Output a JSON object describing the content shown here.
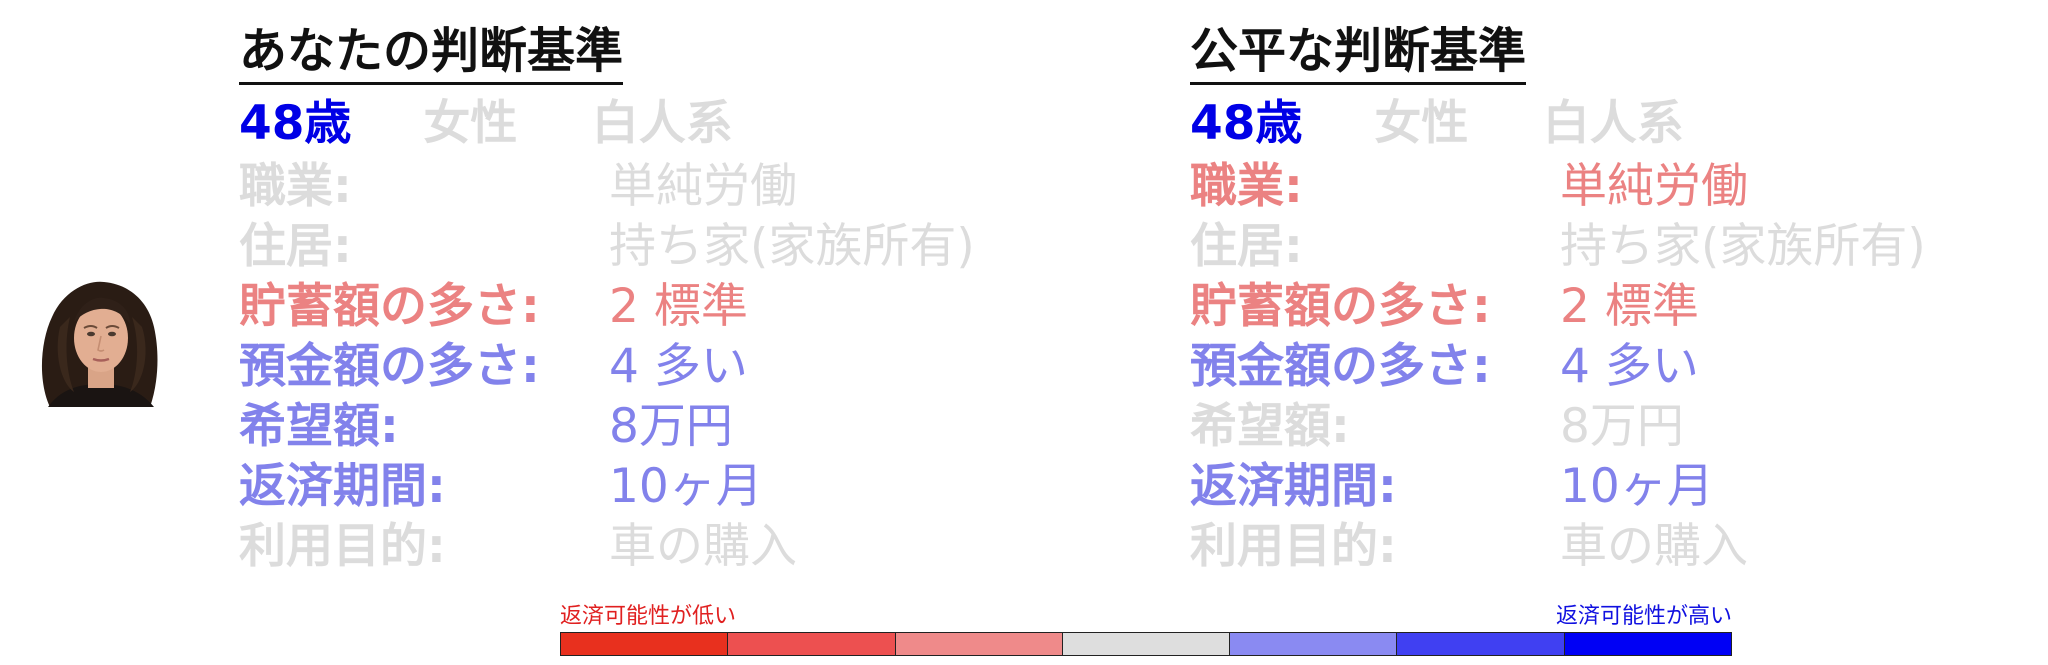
{
  "colors": {
    "age": "#0000e6",
    "gray": "#dcdcdc",
    "red": "#eb8282",
    "blue": "#8282eb",
    "scale": [
      "#e8301e",
      "#ed5050",
      "#ef8a8a",
      "#dedede",
      "#8a8af2",
      "#4040f2",
      "#0000f5"
    ]
  },
  "profile": {
    "age": "48歳",
    "gender": "女性",
    "ethnicity": "白人系"
  },
  "panels": [
    {
      "title": "あなたの判断基準",
      "rows": [
        {
          "label": "職業:",
          "value": "単純労働",
          "tone": "gray"
        },
        {
          "label": "住居:",
          "value": "持ち家(家族所有)",
          "tone": "gray"
        },
        {
          "label": "貯蓄額の多さ:",
          "value": "2 標準",
          "tone": "red"
        },
        {
          "label": "預金額の多さ:",
          "value": "4 多い",
          "tone": "blue"
        },
        {
          "label": "希望額:",
          "value": "8万円",
          "tone": "blue"
        },
        {
          "label": "返済期間:",
          "value": "10ヶ月",
          "tone": "blue"
        },
        {
          "label": "利用目的:",
          "value": "車の購入",
          "tone": "gray"
        }
      ]
    },
    {
      "title": "公平な判断基準",
      "rows": [
        {
          "label": "職業:",
          "value": "単純労働",
          "tone": "red"
        },
        {
          "label": "住居:",
          "value": "持ち家(家族所有)",
          "tone": "gray"
        },
        {
          "label": "貯蓄額の多さ:",
          "value": "2 標準",
          "tone": "red"
        },
        {
          "label": "預金額の多さ:",
          "value": "4 多い",
          "tone": "blue"
        },
        {
          "label": "希望額:",
          "value": "8万円",
          "tone": "gray"
        },
        {
          "label": "返済期間:",
          "value": "10ヶ月",
          "tone": "blue"
        },
        {
          "label": "利用目的:",
          "value": "車の購入",
          "tone": "gray"
        }
      ]
    }
  ],
  "legend": {
    "low_label": "返済可能性が低い",
    "high_label": "返済可能性が高い"
  }
}
